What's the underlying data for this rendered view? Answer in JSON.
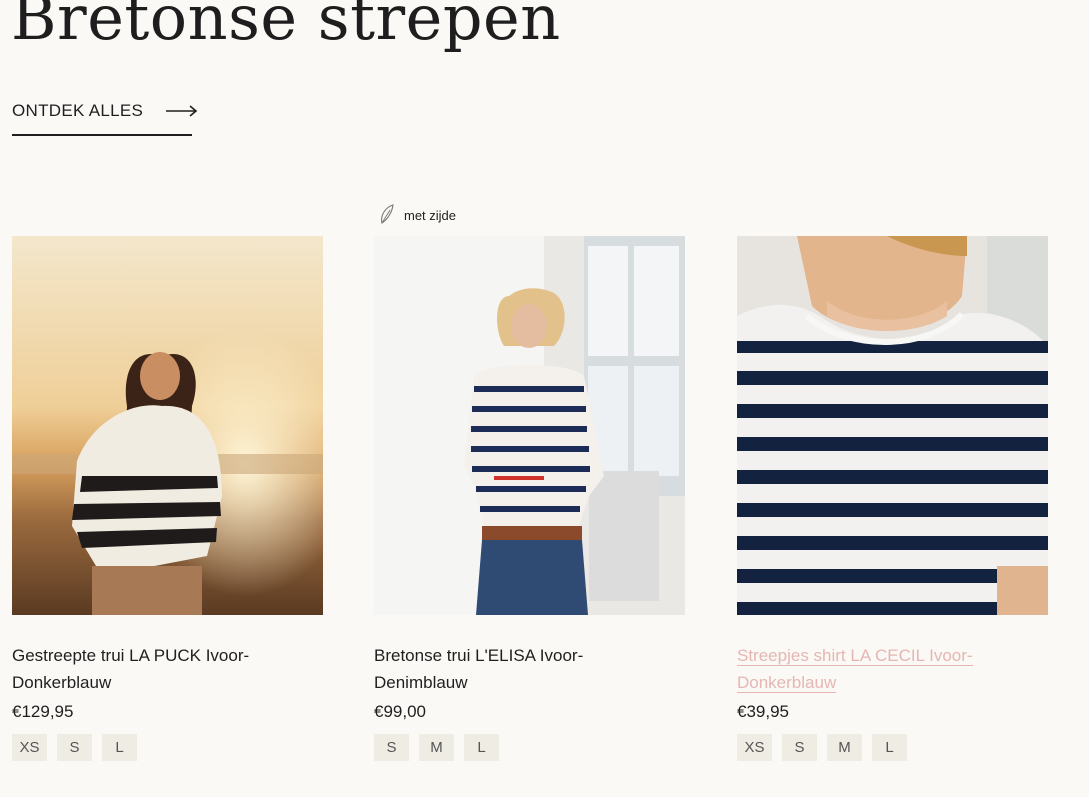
{
  "section": {
    "title": "Bretonse strepen",
    "discover_label": "ONTDEK ALLES"
  },
  "products": [
    {
      "name": "Gestreepte trui LA PUCK Ivoor-Donkerblauw",
      "price": "€129,95",
      "sizes": [
        "XS",
        "S",
        "L"
      ],
      "badge": ""
    },
    {
      "name": "Bretonse trui L'ELISA Ivoor-Denimblauw",
      "price": "€99,00",
      "sizes": [
        "S",
        "M",
        "L"
      ],
      "badge": "met zijde"
    },
    {
      "name": "Streepjes shirt LA CECIL Ivoor-Donkerblauw",
      "price": "€39,95",
      "sizes": [
        "XS",
        "S",
        "M",
        "L"
      ],
      "badge": ""
    }
  ],
  "colors": {
    "background": "#faf9f6",
    "text": "#1f1f1f",
    "hover_link": "#e6b6b2",
    "size_chip": "#efece4",
    "stripe_navy": "#13223f"
  },
  "icons": {
    "discover_arrow": "long-arrow-right-icon",
    "badge": "silk-feather-icon"
  }
}
